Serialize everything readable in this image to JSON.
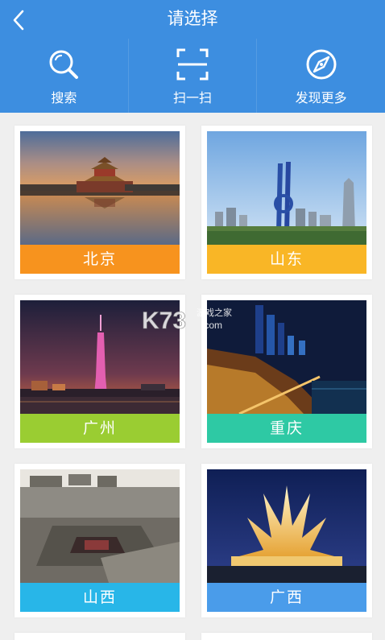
{
  "header": {
    "title": "请选择"
  },
  "toolbar": [
    {
      "label": "搜索",
      "icon": "search-icon"
    },
    {
      "label": "扫一扫",
      "icon": "scan-icon"
    },
    {
      "label": "发现更多",
      "icon": "compass-icon"
    }
  ],
  "cities": [
    {
      "name": "北京",
      "band_color": "#f7931e"
    },
    {
      "name": "山东",
      "band_color": "#f9b626"
    },
    {
      "name": "广州",
      "band_color": "#9acd32"
    },
    {
      "name": "重庆",
      "band_color": "#2ec9a4"
    },
    {
      "name": "山西",
      "band_color": "#28b6e8"
    },
    {
      "name": "广西",
      "band_color": "#4a9cea"
    }
  ],
  "watermark": {
    "text": "K73 游戏之家 .com"
  },
  "colors": {
    "header_bg": "#3d8ee0",
    "page_bg": "#efefef"
  }
}
